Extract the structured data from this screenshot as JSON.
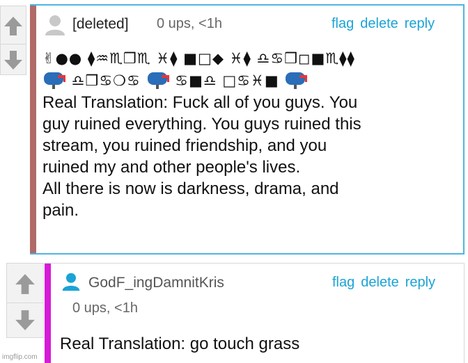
{
  "comment1": {
    "username": "[deleted]",
    "meta": "0 ups, <1h",
    "actions": {
      "flag": "flag",
      "delete": "delete",
      "reply": "reply"
    },
    "wingdings_line1": "✌●● ⧫♒♏❒♏ ♓⧫ ■□◆ ♓⧫ ♎♋❒◻■♏⧫⧫",
    "wingdings_line2a": " ♎❒♋❍♋",
    "wingdings_line2b": " ♋■♎ □♋♓■",
    "translation_lines": [
      "Real Translation: Fuck all of you guys. You",
      "guy ruined everything. You guys ruined this",
      "stream, you ruined friendship, and you",
      "ruined my and other people's lives.",
      "All there is now is darkness, drama, and",
      "pain."
    ],
    "accent_color": "#b06a68"
  },
  "comment2": {
    "username": "GodF_ingDamnitKris",
    "meta": "0 ups, <1h",
    "actions": {
      "flag": "flag",
      "delete": "delete",
      "reply": "reply"
    },
    "body": "Real Translation: go touch grass",
    "accent_color": "#d61ad6",
    "avatar_color": "#1aa3d6"
  },
  "watermark": "imgflip.com",
  "colors": {
    "link": "#1aa3d6",
    "border": "#d8d8d8",
    "comment1_frame": "#4fb4e0"
  },
  "icons": [
    "upvote-arrow-icon",
    "downvote-arrow-icon",
    "user-avatar-icon",
    "mailbox-icon"
  ]
}
